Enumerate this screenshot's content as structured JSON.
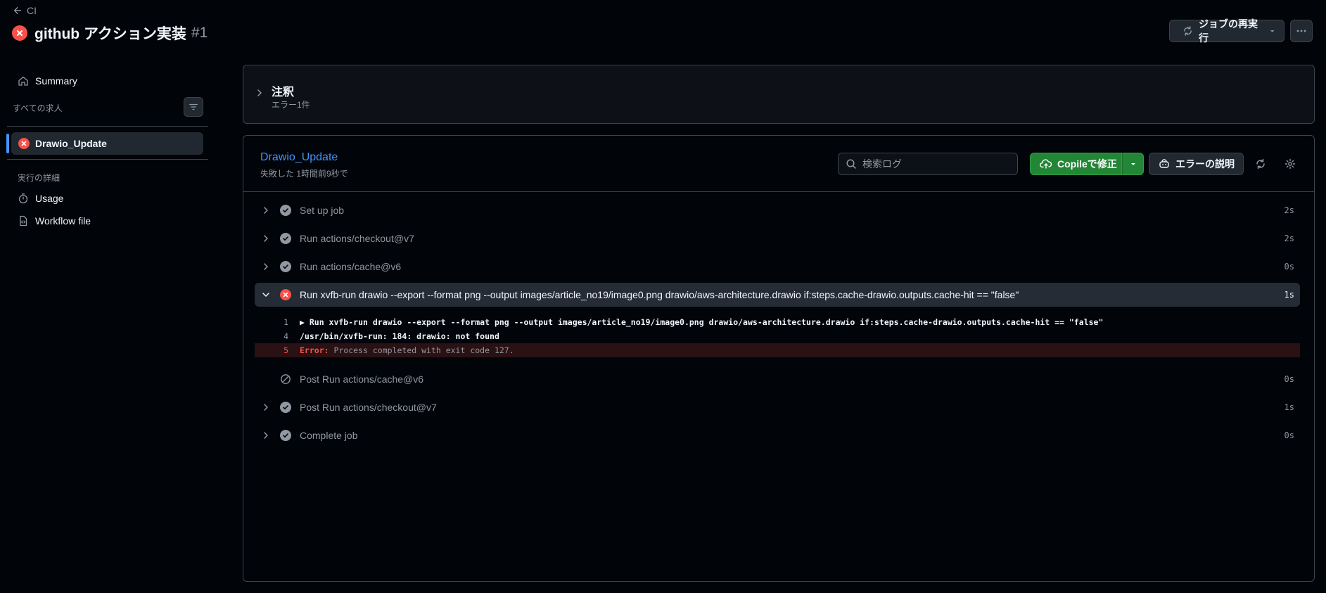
{
  "header": {
    "back_label": "CI",
    "title": "github アクション実装",
    "run_number": "#1",
    "rerun_label": "ジョブの再実行"
  },
  "sidebar": {
    "summary_label": "Summary",
    "all_jobs_label": "すべての求人",
    "active_job": "Drawio_Update",
    "run_details_label": "実行の詳細",
    "usage_label": "Usage",
    "workflow_file_label": "Workflow file"
  },
  "annotations": {
    "title": "注釈",
    "subtitle": "エラー1件"
  },
  "job": {
    "name": "Drawio_Update",
    "meta": "失敗した 1時間前9秒で",
    "search_placeholder": "検索ログ",
    "fix_label": "Copileで修正",
    "explain_label": "エラーの説明"
  },
  "steps": [
    {
      "label": "Set up job",
      "duration": "2s",
      "status": "success"
    },
    {
      "label": "Run actions/checkout@v7",
      "duration": "2s",
      "status": "success"
    },
    {
      "label": "Run actions/cache@v6",
      "duration": "0s",
      "status": "success"
    },
    {
      "label": "Run xvfb-run drawio --export --format png --output images/article_no19/image0.png drawio/aws-architecture.drawio if:steps.cache-drawio.outputs.cache-hit == \"false\"",
      "duration": "1s",
      "status": "failure"
    },
    {
      "label": "Post Run actions/cache@v6",
      "duration": "0s",
      "status": "skipped"
    },
    {
      "label": "Post Run actions/checkout@v7",
      "duration": "1s",
      "status": "success"
    },
    {
      "label": "Complete job",
      "duration": "0s",
      "status": "success"
    }
  ],
  "log_lines": [
    {
      "num": "1",
      "text": "▶ Run xvfb-run drawio --export --format png --output images/article_no19/image0.png drawio/aws-architecture.drawio if:steps.cache-drawio.outputs.cache-hit == \"false\""
    },
    {
      "num": "4",
      "text": "/usr/bin/xvfb-run: 184: drawio: not found"
    },
    {
      "num": "5",
      "error_label": "Error:",
      "text": " Process completed with exit code 127."
    }
  ],
  "colors": {
    "background": "#010409",
    "error": "#f85149",
    "success_button": "#238636",
    "link": "#4493f8"
  }
}
